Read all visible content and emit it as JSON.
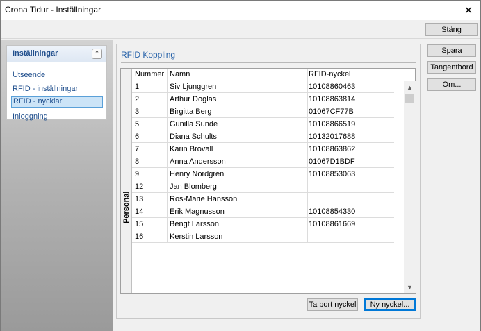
{
  "window": {
    "title": "Crona Tidur - Inställningar",
    "close_glyph": "✕"
  },
  "toolbar": {
    "close_label": "Stäng"
  },
  "sidebar": {
    "header": "Inställningar",
    "collapse_glyph": "⌃",
    "items": [
      {
        "label": "Utseende"
      },
      {
        "label": "RFID - inställningar"
      },
      {
        "label": "RFID - nycklar",
        "selected": true
      },
      {
        "label": "Inloggning"
      }
    ]
  },
  "actions": {
    "save_label": "Spara",
    "keyboard_label": "Tangentbord",
    "about_label": "Om..."
  },
  "rfid": {
    "group_title": "RFID Koppling",
    "side_tab": "Personal",
    "columns": {
      "number": "Nummer",
      "name": "Namn",
      "key": "RFID-nyckel"
    },
    "rows": [
      {
        "number": "1",
        "name": "Siv Ljunggren",
        "key": "10108860463"
      },
      {
        "number": "2",
        "name": "Arthur Doglas",
        "key": "10108863814"
      },
      {
        "number": "3",
        "name": "Birgitta Berg",
        "key": "01067CF77B"
      },
      {
        "number": "5",
        "name": "Gunilla Sunde",
        "key": "10108866519"
      },
      {
        "number": "6",
        "name": "Diana Schults",
        "key": "10132017688"
      },
      {
        "number": "7",
        "name": "Karin Brovall",
        "key": "10108863862"
      },
      {
        "number": "8",
        "name": "Anna Andersson",
        "key": "01067D1BDF"
      },
      {
        "number": "9",
        "name": "Henry Nordgren",
        "key": "10108853063"
      },
      {
        "number": "12",
        "name": "Jan Blomberg",
        "key": ""
      },
      {
        "number": "13",
        "name": "Ros-Marie Hansson",
        "key": ""
      },
      {
        "number": "14",
        "name": "Erik Magnusson",
        "key": "10108854330"
      },
      {
        "number": "15",
        "name": "Bengt Larsson",
        "key": "10108861669"
      },
      {
        "number": "16",
        "name": "Kerstin Larsson",
        "key": ""
      }
    ],
    "delete_key_label": "Ta bort nyckel",
    "new_key_label": "Ny nyckel..."
  },
  "scroll": {
    "up_glyph": "▲",
    "down_glyph": "▼"
  },
  "colors": {
    "accent": "#1f4e8c",
    "selection": "#cce4f7",
    "focus": "#0078d7"
  }
}
